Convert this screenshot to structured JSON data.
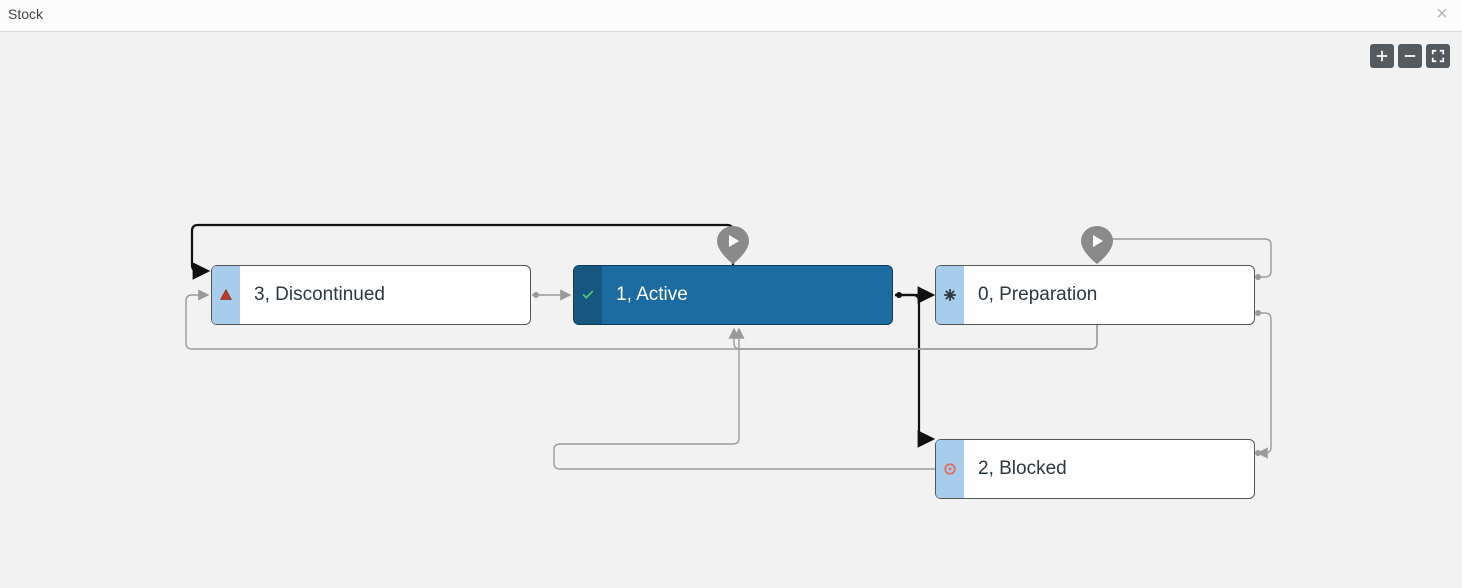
{
  "header": {
    "title": "Stock",
    "close_symbol": "×"
  },
  "toolbar": {
    "zoom_in": "zoom-in",
    "zoom_out": "zoom-out",
    "fit": "fit-screen"
  },
  "nodes": {
    "discontinued": {
      "label": "3, Discontinued",
      "icon": "warning-triangle",
      "status_color": "#c0392b"
    },
    "active": {
      "label": "1, Active",
      "icon": "check",
      "status_color": "#4ec07a",
      "selected": true
    },
    "preparation": {
      "label": "0, Preparation",
      "icon": "asterisk",
      "status_color": "#2c3841"
    },
    "blocked": {
      "label": "2, Blocked",
      "icon": "stop-circle",
      "status_color": "#e46b5a"
    }
  },
  "pins": {
    "above_active": "play",
    "above_preparation": "play"
  },
  "edges": [
    {
      "from": "active",
      "to": "discontinued",
      "weight": "bold"
    },
    {
      "from": "active",
      "to": "preparation",
      "weight": "bold"
    },
    {
      "from": "active",
      "to": "blocked",
      "weight": "bold"
    },
    {
      "from": "discontinued",
      "to": "active",
      "weight": "light"
    },
    {
      "from": "preparation",
      "to": "active",
      "weight": "light"
    },
    {
      "from": "preparation",
      "to": "discontinued",
      "weight": "light"
    },
    {
      "from": "preparation",
      "to": "blocked",
      "weight": "light"
    },
    {
      "from": "blocked",
      "to": "active",
      "weight": "light"
    },
    {
      "from": "preparation",
      "to": "preparation",
      "weight": "light",
      "self_loop": true
    }
  ],
  "colors": {
    "accent_stripe": "#a8cceb",
    "active_fill": "#1d6ca1",
    "active_stripe": "#16567f",
    "edge_bold": "#111",
    "edge_light": "#9a9a9a"
  }
}
